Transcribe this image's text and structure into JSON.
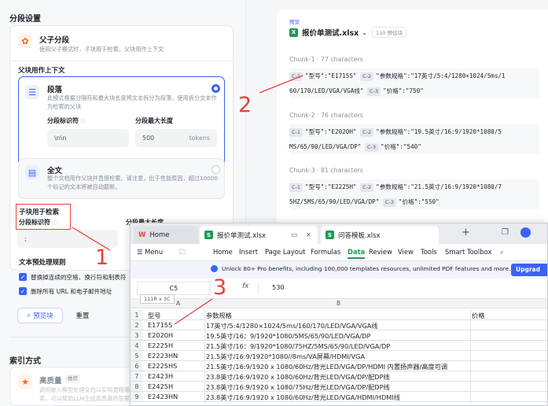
{
  "segment_settings": {
    "title": "分段设置",
    "parent_child": {
      "title": "父子分段",
      "desc": "使用父子模式时，子块用于检索，父块用作上下文"
    },
    "parent_context_title": "父块用作上下文",
    "paragraph": {
      "title": "段落",
      "desc": "此模式根据分隔符和最大块长度将文本拆分为段落，使用拆分文本作为检索的父块",
      "sep_label": "分段标识符",
      "sep_value": "\\n\\n",
      "max_label": "分段最大长度",
      "max_value": "500",
      "max_unit": "tokens"
    },
    "fulltext": {
      "title": "全文",
      "desc": "整个文档用作父块并直接检索。请注意，出于性能原因，超过10000个标记的文本将被自动截断。"
    },
    "child_retrieval_title": "子块用于检索",
    "child_sep_label": "分段标识符",
    "child_sep_value": ";",
    "child_max_label": "分段最大长度",
    "preprocess_title": "文本预处理规则",
    "rule1": "替换掉连续的空格、换行符和制表符",
    "rule2": "删除所有 URL 和电子邮件地址",
    "preview_button": "预览块",
    "reset_button": "重置",
    "index_title": "索引方式",
    "index_option": "高质量",
    "index_badge": "推荐",
    "index_desc": "调用嵌入模型处理文档以实现更精确的检索，可以帮助LLM生成高质量的答案。"
  },
  "preview": {
    "label": "预览",
    "file_name": "报价单测试.xlsx",
    "chunk_count": "110 预估块",
    "chunks": [
      {
        "head": "Chunk-1 · 77 characters",
        "l1": "\"型号\":\"E1715S\"",
        "l2": "\"参数规格\":\"17英寸/5:4/1280×1024/5ms/1",
        "l3": "60/170/LED/VGA/VGA线\"",
        "l4": "\"价格\":\"750\""
      },
      {
        "head": "Chunk-2 · 76 characters",
        "l1": "\"型号\":\"E2020H\"",
        "l2": "\"参数规格\":\"19.5英寸/16:9/1920*1080/5",
        "l3": "MS/65/90/LED/VGA/DP\"",
        "l4": "\"价格\":\"540\""
      },
      {
        "head": "Chunk-3 · 81 characters",
        "l1": "\"型号\":\"E2225H\"",
        "l2": "\"参数规格\":\"21.5英寸/16:9/1920*1080/7",
        "l3": "5HZ/5MS/65/90/LED/VGA/DP\"",
        "l4": "\"价格\":\"550\""
      }
    ],
    "tags": {
      "c1": "C-1",
      "c2": "C-2",
      "c3": "C-3"
    }
  },
  "excel": {
    "tabs": [
      {
        "label": "Home"
      },
      {
        "label": "报价单测试.xlsx"
      },
      {
        "label": "问答模板.xlsx"
      }
    ],
    "menu": [
      "Menu",
      "Home",
      "Insert",
      "Page Layout",
      "Formulas",
      "Data",
      "Review",
      "View",
      "Tools",
      "Smart Toolbox"
    ],
    "active_menu": "Data",
    "banner": "Unlock 80+ Pro benefits, including 100,000 templates resources, unlimited PDF features and more.",
    "upgrade": "Upgrad",
    "cell_ref": "C5",
    "fx": "fx",
    "formula_value": "530",
    "tooltip": "111R x 3C",
    "columns": [
      "A",
      "B"
    ],
    "rows": [
      {
        "n": "1",
        "a": "型号",
        "b": "参数规格",
        "c": "价格"
      },
      {
        "n": "2",
        "a": "E1715S",
        "b": "17英寸/5:4/1280×1024/5ms/160/170/LED/VGA/VGA线",
        "c": ""
      },
      {
        "n": "3",
        "a": "E2020H",
        "b": "19.5英寸/16：9/1920*1080/5MS/65/90/LED/VGA/DP",
        "c": ""
      },
      {
        "n": "4",
        "a": "E2225H",
        "b": "21.5英寸/16：9/1920*1080/75HZ/5MS/65/90/LED/VGA/DP",
        "c": ""
      },
      {
        "n": "5",
        "a": "E2223HN",
        "b": "21.5英寸/16:9/1920*1080//8ms/VA屏幕/HDMI/VGA",
        "c": ""
      },
      {
        "n": "6",
        "a": "E2225HS",
        "b": "21.5英寸/16:9/1920 x 1080/60Hz/背光LED/VGA/DP/HDMI 内置扬声器/高度可调",
        "c": ""
      },
      {
        "n": "7",
        "a": "E2423H",
        "b": "23.8英寸/16:9/1920 x 1080/60Hz/背光LED/VGA/DP/配DP线",
        "c": ""
      },
      {
        "n": "8",
        "a": "E2425H",
        "b": "23.8英寸/16:9/1920 x 1080/75Hz/背光LED/VGA/DP/配DP线",
        "c": ""
      },
      {
        "n": "9",
        "a": "E2423HN",
        "b": "23.8英寸/16:9/1920 x 1080/60Hz/背光LED/VGA/HDMI/HDMI线",
        "c": ""
      }
    ]
  },
  "annotations": [
    "1",
    "2",
    "3"
  ],
  "colors": {
    "accent": "#3b62f5",
    "annotation": "#e8413b",
    "excel_green": "#1f9a55"
  }
}
